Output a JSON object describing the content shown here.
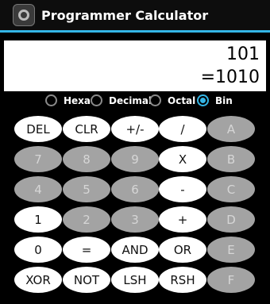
{
  "app": {
    "title": "Programmer Calculator"
  },
  "display": {
    "input": "101",
    "result": "=1010"
  },
  "radix": {
    "options": [
      "Hexa",
      "Decimal",
      "Octal",
      "Bin"
    ],
    "selected": "Bin"
  },
  "keys": [
    [
      "DEL",
      "CLR",
      "+/-",
      "/",
      "A"
    ],
    [
      "7",
      "8",
      "9",
      "X",
      "B"
    ],
    [
      "4",
      "5",
      "6",
      "-",
      "C"
    ],
    [
      "1",
      "2",
      "3",
      "+",
      "D"
    ],
    [
      "0",
      "=",
      "AND",
      "OR",
      "E"
    ],
    [
      "XOR",
      "NOT",
      "LSH",
      "RSH",
      "F"
    ]
  ],
  "colors": {
    "accent": "#33b5e5",
    "key_enabled": "#ffffff",
    "key_disabled": "#a3a3a3"
  }
}
